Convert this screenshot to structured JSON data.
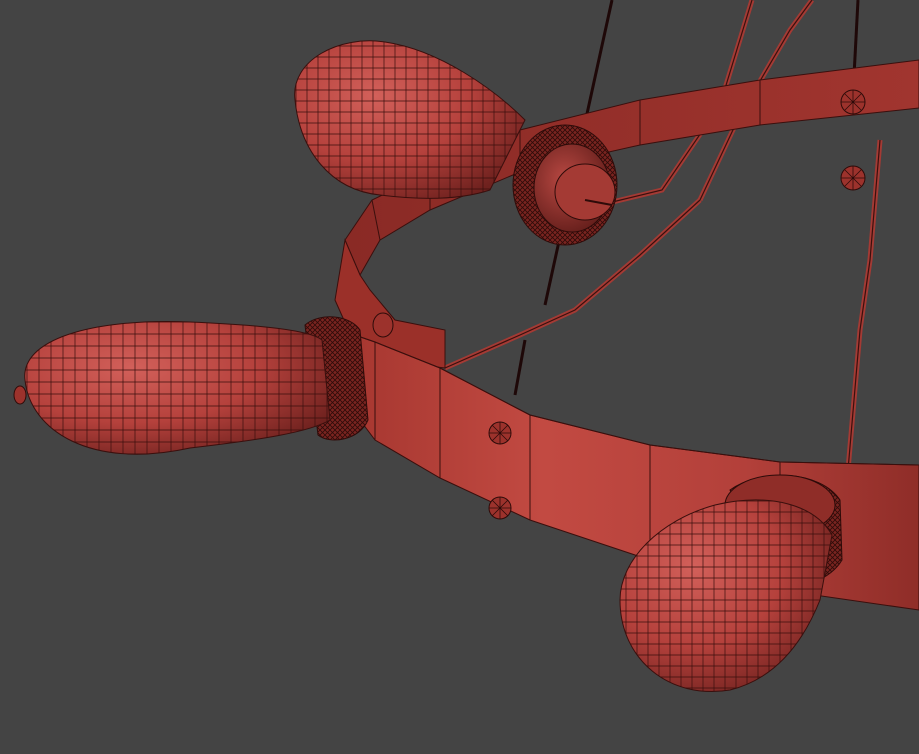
{
  "scene": {
    "background_color": "#444444",
    "model_color": "#b5413c",
    "model_shadow_color": "#6e211e",
    "model_highlight_color": "#cf5a52",
    "wire_color": "#3a0f0d",
    "cable_color": "#1e0808",
    "objects": [
      "ring-band",
      "bulb-left",
      "bulb-top",
      "bulb-bottom-right",
      "socket-left",
      "socket-top",
      "socket-bottom-right",
      "rivet-group-front",
      "rivet-group-back",
      "support-cables",
      "support-rods"
    ]
  }
}
